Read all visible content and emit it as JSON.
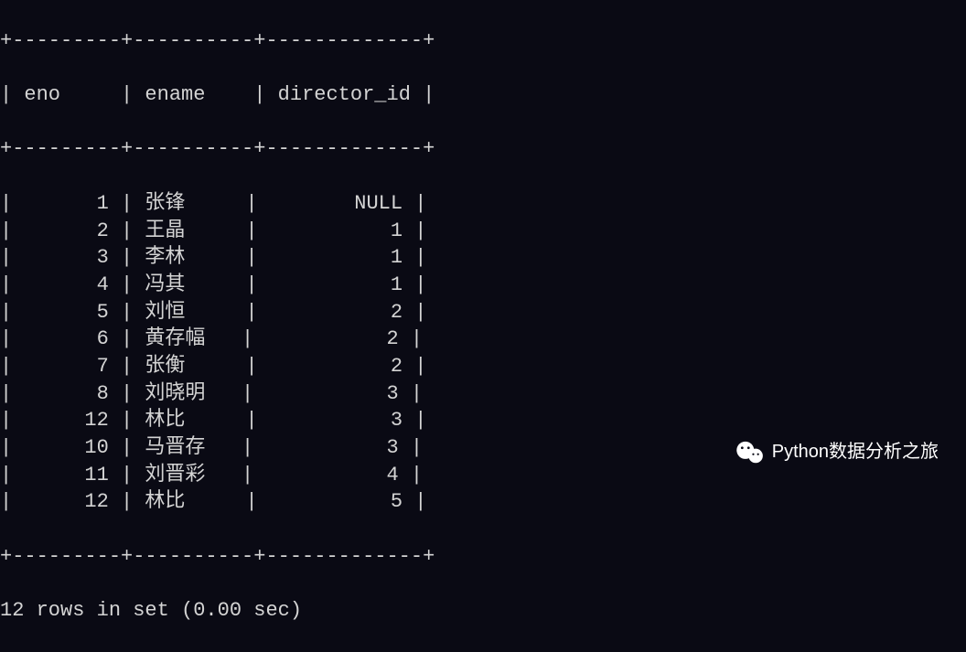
{
  "table": {
    "border_top": "+---------+----------+-------------+",
    "headers": {
      "col1": "eno",
      "col2": "ename",
      "col3": "director_id"
    },
    "rows": [
      {
        "eno": "1",
        "ename": "张锋",
        "director_id": "NULL"
      },
      {
        "eno": "2",
        "ename": "王晶",
        "director_id": "1"
      },
      {
        "eno": "3",
        "ename": "李林",
        "director_id": "1"
      },
      {
        "eno": "4",
        "ename": "冯其",
        "director_id": "1"
      },
      {
        "eno": "5",
        "ename": "刘恒",
        "director_id": "2"
      },
      {
        "eno": "6",
        "ename": "黄存幅",
        "director_id": "2"
      },
      {
        "eno": "7",
        "ename": "张衡",
        "director_id": "2"
      },
      {
        "eno": "8",
        "ename": "刘晓明",
        "director_id": "3"
      },
      {
        "eno": "12",
        "ename": "林比",
        "director_id": "3"
      },
      {
        "eno": "10",
        "ename": "马晋存",
        "director_id": "3"
      },
      {
        "eno": "11",
        "ename": "刘晋彩",
        "director_id": "4"
      },
      {
        "eno": "12",
        "ename": "林比",
        "director_id": "5"
      }
    ]
  },
  "status": "12 rows in set (0.00 sec)",
  "watermark": "Python数据分析之旅"
}
